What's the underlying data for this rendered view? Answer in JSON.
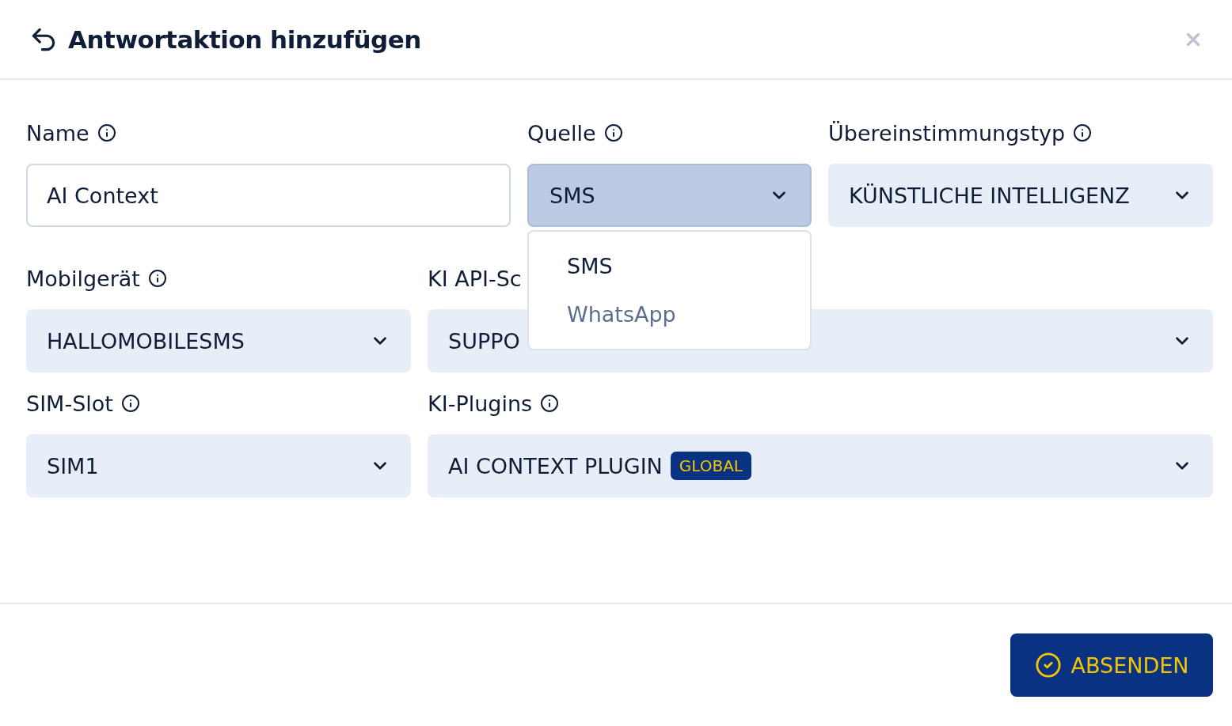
{
  "dialog": {
    "title": "Antwortaktion hinzufügen"
  },
  "rows": [
    [
      {
        "label": "Name",
        "kind": "text",
        "value": "AI Context"
      },
      {
        "label": "Quelle",
        "kind": "select",
        "value": "SMS",
        "expanded": true,
        "options": [
          {
            "label": "SMS",
            "selected": true
          },
          {
            "label": "WhatsApp",
            "selected": false
          }
        ]
      },
      {
        "label": "Übereinstimmungstyp",
        "kind": "select",
        "value": "KÜNSTLICHE INTELLIGENZ",
        "expanded": false
      }
    ],
    [
      {
        "label": "Mobilgerät",
        "kind": "select",
        "value": "HALLOMOBILESMS",
        "expanded": false
      },
      {
        "label": "KI API-Sc",
        "kind": "select",
        "value": "SUPPO",
        "expanded": false
      }
    ],
    [
      {
        "label": "SIM-Slot",
        "kind": "select",
        "value": "SIM1",
        "expanded": false
      },
      {
        "label": "KI-Plugins",
        "kind": "select",
        "value": "AI CONTEXT PLUGIN",
        "badge": "GLOBAL",
        "expanded": false
      }
    ]
  ],
  "submit_button": "ABSENDEN"
}
